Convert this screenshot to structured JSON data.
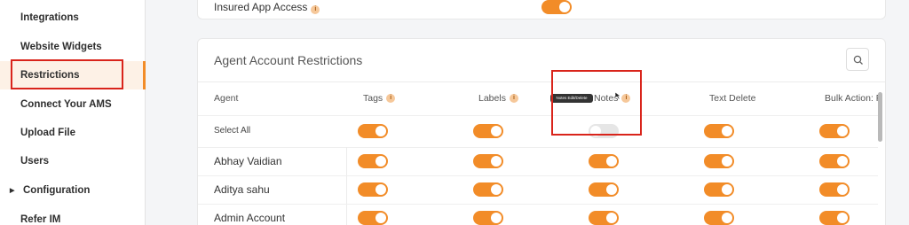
{
  "sidebar": {
    "items": [
      {
        "label": "Integrations"
      },
      {
        "label": "Website Widgets"
      },
      {
        "label": "Restrictions",
        "active": true
      },
      {
        "label": "Connect Your AMS"
      },
      {
        "label": "Upload File"
      },
      {
        "label": "Users"
      },
      {
        "label": "Configuration",
        "expandable": true
      },
      {
        "label": "Refer IM"
      }
    ]
  },
  "top_section": {
    "label": "Insured App Access",
    "toggle_on": true
  },
  "agent_restrictions": {
    "title": "Agent Account Restrictions",
    "search_icon": "search-icon",
    "columns": [
      {
        "label": "Agent",
        "info": false
      },
      {
        "label": "Tags",
        "info": true
      },
      {
        "label": "Labels",
        "info": true
      },
      {
        "label": "Notes",
        "info": true
      },
      {
        "label": "Text Delete",
        "info": false
      },
      {
        "label": "Bulk Action: F",
        "info": false
      }
    ],
    "info_glyph": "i",
    "select_all": {
      "label": "Select All",
      "toggles": [
        true,
        true,
        false,
        true,
        true
      ]
    },
    "rows": [
      {
        "name": "Abhay Vaidian",
        "toggles": [
          true,
          true,
          true,
          true,
          true
        ]
      },
      {
        "name": "Aditya sahu",
        "toggles": [
          true,
          true,
          true,
          true,
          true
        ]
      },
      {
        "name": "Admin Account",
        "toggles": [
          true,
          true,
          true,
          true,
          true
        ]
      }
    ],
    "tooltip": "Notes Edit/Delete"
  },
  "colors": {
    "accent": "#f28c28",
    "annotation": "#d9241b"
  }
}
